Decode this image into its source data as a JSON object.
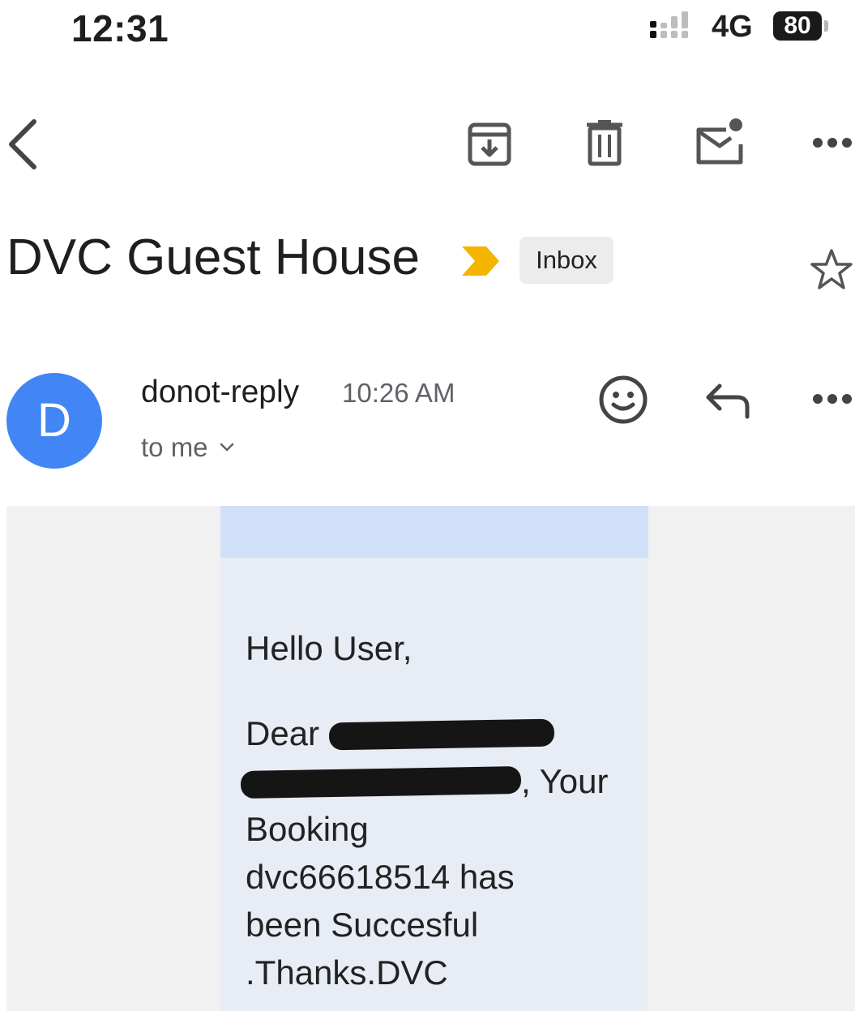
{
  "status_bar": {
    "time": "12:31",
    "network": "4G",
    "battery": "80"
  },
  "toolbar": {
    "back_icon": "chevron-left-icon",
    "archive_icon": "archive-icon",
    "delete_icon": "trash-icon",
    "mark_unread_icon": "mark-unread-icon",
    "more_icon": "more-horizontal-icon"
  },
  "email": {
    "subject": "DVC Guest House",
    "label": "Inbox",
    "importance_color": "#f4b400",
    "sender_initial": "D",
    "avatar_color": "#4285f4",
    "sender": "donot-reply",
    "time": "10:26 AM",
    "recipient": "to me",
    "body": {
      "greeting": "Hello User,",
      "dear": "Dear",
      "your": ", Your",
      "line_booking": "Booking",
      "line_id": "dvc66618514 has",
      "line_success": "been Succesful",
      "line_thanks": ".Thanks.DVC"
    }
  }
}
